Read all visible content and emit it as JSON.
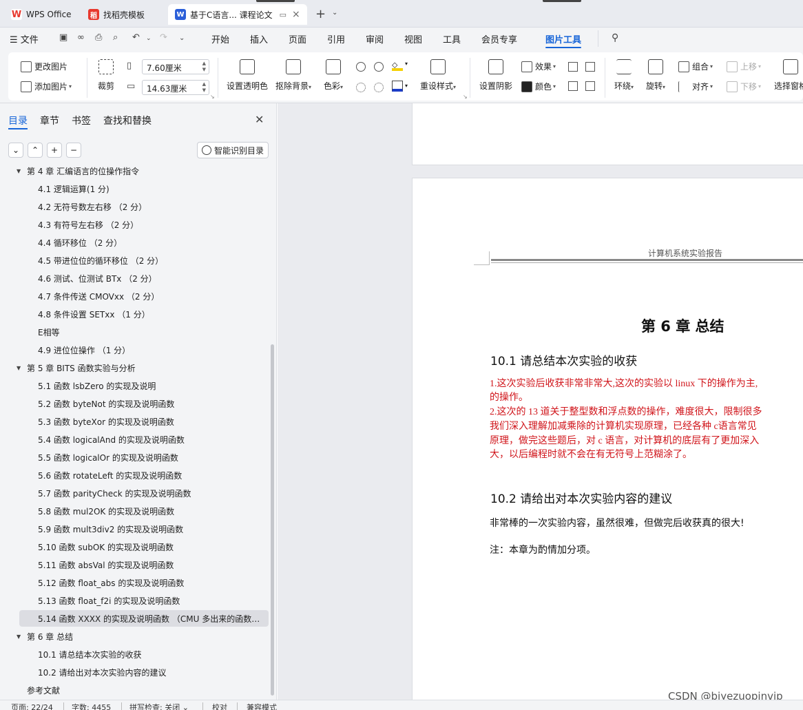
{
  "tabs": [
    {
      "label": "WPS Office",
      "icon": "wps-logo-icon",
      "color": "#e8382e"
    },
    {
      "label": "找稻壳模板",
      "icon": "docer-icon",
      "color": "#e8382e"
    },
    {
      "label": "基于C语言... 课程论文",
      "icon": "word-doc-icon",
      "color": "#2b5fd9"
    }
  ],
  "menubar": {
    "file_label": "文件",
    "items": [
      "开始",
      "插入",
      "页面",
      "引用",
      "审阅",
      "视图",
      "工具",
      "会员专享",
      "图片工具"
    ],
    "active": "图片工具"
  },
  "ribbon": {
    "change_image": "更改图片",
    "add_image": "添加图片",
    "crop": "裁剪",
    "width_value": "7.60厘米",
    "height_value": "14.63厘米",
    "set_transparent": "设置透明色",
    "remove_bg": "抠除背景",
    "color_tone": "色彩",
    "reset_style": "重设样式",
    "set_shadow": "设置阴影",
    "effect": "效果",
    "color": "颜色",
    "wrap": "环绕",
    "rotate": "旋转",
    "group": "组合",
    "align": "对齐",
    "bring_forward": "上移",
    "send_backward": "下移",
    "selection_pane": "选择窗格"
  },
  "panel": {
    "tabs": [
      "目录",
      "章节",
      "书签",
      "查找和替换"
    ],
    "active_tab": "目录",
    "smart_toc_label": "智能识别目录",
    "toc": [
      {
        "level": 1,
        "text": "第 4 章 汇编语言的位操作指令",
        "expanded": true
      },
      {
        "level": 2,
        "text": "4.1 逻辑运算(1 分)"
      },
      {
        "level": 2,
        "text": "4.2 无符号数左右移 （2 分）"
      },
      {
        "level": 2,
        "text": "4.3 有符号左右移 （2 分）"
      },
      {
        "level": 2,
        "text": "4.4 循环移位 （2 分）"
      },
      {
        "level": 2,
        "text": "4.5 带进位位的循环移位 （2 分）"
      },
      {
        "level": 2,
        "text": "4.6 测试、位测试 BTx （2 分）"
      },
      {
        "level": 2,
        "text": "4.7 条件传送 CMOVxx （2 分）"
      },
      {
        "level": 2,
        "text": "4.8 条件设置 SETxx （1 分）"
      },
      {
        "level": 2,
        "text": "E相等"
      },
      {
        "level": 2,
        "text": "4.9 进位位操作 （1 分）"
      },
      {
        "level": 1,
        "text": "第 5 章 BITS 函数实验与分析",
        "expanded": true
      },
      {
        "level": 2,
        "text": "5.1 函数 lsbZero 的实现及说明"
      },
      {
        "level": 2,
        "text": "5.2 函数 byteNot 的实现及说明函数"
      },
      {
        "level": 2,
        "text": "5.3 函数 byteXor 的实现及说明函数"
      },
      {
        "level": 2,
        "text": "5.4 函数 logicalAnd 的实现及说明函数"
      },
      {
        "level": 2,
        "text": "5.5 函数 logicalOr 的实现及说明函数"
      },
      {
        "level": 2,
        "text": "5.6 函数 rotateLeft 的实现及说明函数"
      },
      {
        "level": 2,
        "text": "5.7 函数 parityCheck 的实现及说明函数"
      },
      {
        "level": 2,
        "text": "5.8 函数 mul2OK 的实现及说明函数"
      },
      {
        "level": 2,
        "text": "5.9 函数 mult3div2 的实现及说明函数"
      },
      {
        "level": 2,
        "text": "5.10 函数 subOK 的实现及说明函数"
      },
      {
        "level": 2,
        "text": "5.11 函数 absVal 的实现及说明函数"
      },
      {
        "level": 2,
        "text": "5.12 函数 float_abs 的实现及说明函数"
      },
      {
        "level": 2,
        "text": "5.13 函数 float_f2i 的实现及说明函数"
      },
      {
        "level": 2,
        "text": "5.14 函数 XXXX 的实现及说明函数 （CMU 多出来的函数- ...",
        "selected": true
      },
      {
        "level": 1,
        "text": "第 6 章 总结",
        "expanded": true
      },
      {
        "level": 2,
        "text": "10.1 请总结本次实验的收获"
      },
      {
        "level": 2,
        "text": "10.2 请给出对本次实验内容的建议"
      },
      {
        "level": 1,
        "text": "参考文献"
      }
    ]
  },
  "document": {
    "header": "计算机系统实验报告",
    "chapter_title": "第 6 章  总结",
    "sec1_title": "10.1  请总结本次实验的收获",
    "sec1_lines": [
      "1.这次实验后收获非常非常大,这次的实验以 linux 下的操作为主,",
      "的操作。",
      "2.这次的 13 道关于整型数和浮点数的操作，难度很大，限制很多",
      "我们深入理解加减乘除的计算机实现原理，已经各种 c语言常见",
      "原理，做完这些题后，对 c 语言，对计算机的底层有了更加深入",
      "大，以后编程时就不会在有无符号上范糊涂了。"
    ],
    "sec2_title": "10.2  请给出对本次实验内容的建议",
    "sec2_text": "非常棒的一次实验内容，虽然很难，但做完后收获真的很大!",
    "note": "注：本章为酌情加分项。",
    "red_color": "#d0141a"
  },
  "watermark": "CSDN @biyezuopinvip",
  "status": {
    "page": "页面: 22/24",
    "words": "字数: 4455",
    "spell": "拼写检查: 关闭",
    "proof": "校对",
    "compat": "兼容模式"
  },
  "accent_color": "#1664d8"
}
